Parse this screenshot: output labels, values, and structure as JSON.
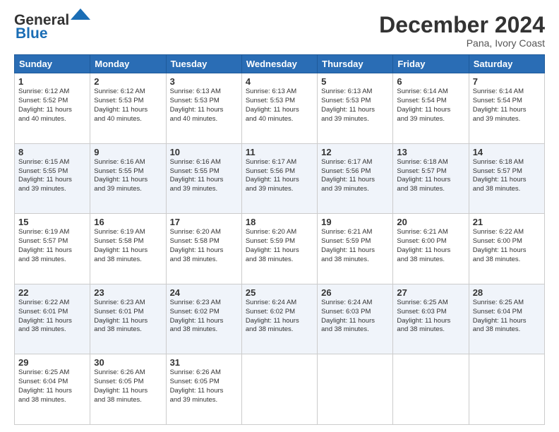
{
  "header": {
    "logo_line1a": "General",
    "logo_line1b": "",
    "logo_line2": "Blue",
    "month_title": "December 2024",
    "location": "Pana, Ivory Coast"
  },
  "days_of_week": [
    "Sunday",
    "Monday",
    "Tuesday",
    "Wednesday",
    "Thursday",
    "Friday",
    "Saturday"
  ],
  "weeks": [
    [
      {
        "num": "1",
        "info": "Sunrise: 6:12 AM\nSunset: 5:52 PM\nDaylight: 11 hours\nand 40 minutes."
      },
      {
        "num": "2",
        "info": "Sunrise: 6:12 AM\nSunset: 5:53 PM\nDaylight: 11 hours\nand 40 minutes."
      },
      {
        "num": "3",
        "info": "Sunrise: 6:13 AM\nSunset: 5:53 PM\nDaylight: 11 hours\nand 40 minutes."
      },
      {
        "num": "4",
        "info": "Sunrise: 6:13 AM\nSunset: 5:53 PM\nDaylight: 11 hours\nand 40 minutes."
      },
      {
        "num": "5",
        "info": "Sunrise: 6:13 AM\nSunset: 5:53 PM\nDaylight: 11 hours\nand 39 minutes."
      },
      {
        "num": "6",
        "info": "Sunrise: 6:14 AM\nSunset: 5:54 PM\nDaylight: 11 hours\nand 39 minutes."
      },
      {
        "num": "7",
        "info": "Sunrise: 6:14 AM\nSunset: 5:54 PM\nDaylight: 11 hours\nand 39 minutes."
      }
    ],
    [
      {
        "num": "8",
        "info": "Sunrise: 6:15 AM\nSunset: 5:55 PM\nDaylight: 11 hours\nand 39 minutes."
      },
      {
        "num": "9",
        "info": "Sunrise: 6:16 AM\nSunset: 5:55 PM\nDaylight: 11 hours\nand 39 minutes."
      },
      {
        "num": "10",
        "info": "Sunrise: 6:16 AM\nSunset: 5:55 PM\nDaylight: 11 hours\nand 39 minutes."
      },
      {
        "num": "11",
        "info": "Sunrise: 6:17 AM\nSunset: 5:56 PM\nDaylight: 11 hours\nand 39 minutes."
      },
      {
        "num": "12",
        "info": "Sunrise: 6:17 AM\nSunset: 5:56 PM\nDaylight: 11 hours\nand 39 minutes."
      },
      {
        "num": "13",
        "info": "Sunrise: 6:18 AM\nSunset: 5:57 PM\nDaylight: 11 hours\nand 38 minutes."
      },
      {
        "num": "14",
        "info": "Sunrise: 6:18 AM\nSunset: 5:57 PM\nDaylight: 11 hours\nand 38 minutes."
      }
    ],
    [
      {
        "num": "15",
        "info": "Sunrise: 6:19 AM\nSunset: 5:57 PM\nDaylight: 11 hours\nand 38 minutes."
      },
      {
        "num": "16",
        "info": "Sunrise: 6:19 AM\nSunset: 5:58 PM\nDaylight: 11 hours\nand 38 minutes."
      },
      {
        "num": "17",
        "info": "Sunrise: 6:20 AM\nSunset: 5:58 PM\nDaylight: 11 hours\nand 38 minutes."
      },
      {
        "num": "18",
        "info": "Sunrise: 6:20 AM\nSunset: 5:59 PM\nDaylight: 11 hours\nand 38 minutes."
      },
      {
        "num": "19",
        "info": "Sunrise: 6:21 AM\nSunset: 5:59 PM\nDaylight: 11 hours\nand 38 minutes."
      },
      {
        "num": "20",
        "info": "Sunrise: 6:21 AM\nSunset: 6:00 PM\nDaylight: 11 hours\nand 38 minutes."
      },
      {
        "num": "21",
        "info": "Sunrise: 6:22 AM\nSunset: 6:00 PM\nDaylight: 11 hours\nand 38 minutes."
      }
    ],
    [
      {
        "num": "22",
        "info": "Sunrise: 6:22 AM\nSunset: 6:01 PM\nDaylight: 11 hours\nand 38 minutes."
      },
      {
        "num": "23",
        "info": "Sunrise: 6:23 AM\nSunset: 6:01 PM\nDaylight: 11 hours\nand 38 minutes."
      },
      {
        "num": "24",
        "info": "Sunrise: 6:23 AM\nSunset: 6:02 PM\nDaylight: 11 hours\nand 38 minutes."
      },
      {
        "num": "25",
        "info": "Sunrise: 6:24 AM\nSunset: 6:02 PM\nDaylight: 11 hours\nand 38 minutes."
      },
      {
        "num": "26",
        "info": "Sunrise: 6:24 AM\nSunset: 6:03 PM\nDaylight: 11 hours\nand 38 minutes."
      },
      {
        "num": "27",
        "info": "Sunrise: 6:25 AM\nSunset: 6:03 PM\nDaylight: 11 hours\nand 38 minutes."
      },
      {
        "num": "28",
        "info": "Sunrise: 6:25 AM\nSunset: 6:04 PM\nDaylight: 11 hours\nand 38 minutes."
      }
    ],
    [
      {
        "num": "29",
        "info": "Sunrise: 6:25 AM\nSunset: 6:04 PM\nDaylight: 11 hours\nand 38 minutes."
      },
      {
        "num": "30",
        "info": "Sunrise: 6:26 AM\nSunset: 6:05 PM\nDaylight: 11 hours\nand 38 minutes."
      },
      {
        "num": "31",
        "info": "Sunrise: 6:26 AM\nSunset: 6:05 PM\nDaylight: 11 hours\nand 39 minutes."
      },
      {
        "num": "",
        "info": ""
      },
      {
        "num": "",
        "info": ""
      },
      {
        "num": "",
        "info": ""
      },
      {
        "num": "",
        "info": ""
      }
    ]
  ]
}
